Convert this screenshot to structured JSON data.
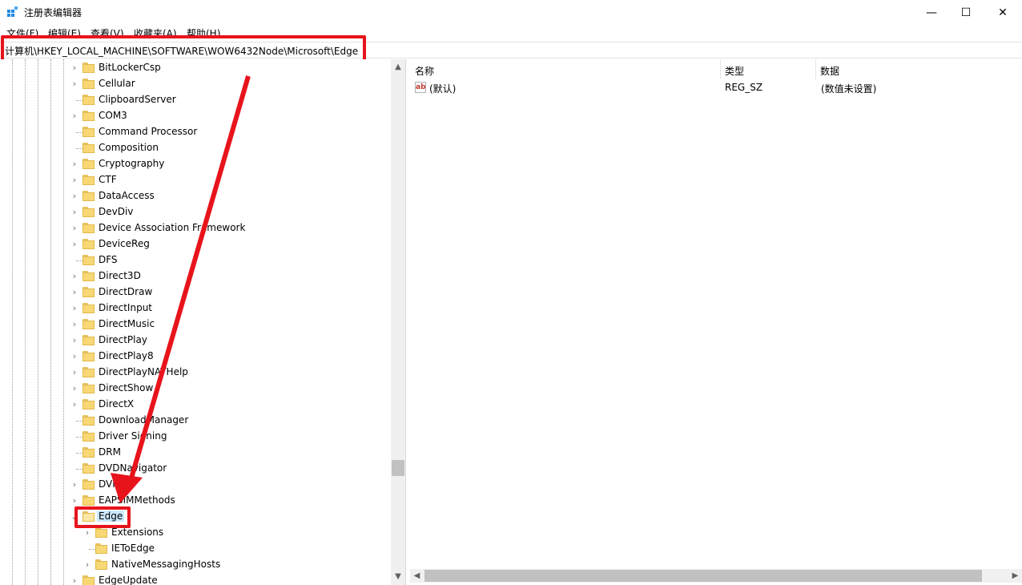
{
  "window": {
    "title": "注册表编辑器",
    "minimize_glyph": "—",
    "maximize_glyph": "☐",
    "close_glyph": "✕"
  },
  "menu": {
    "file": "文件(F)",
    "edit": "编辑(E)",
    "view": "查看(V)",
    "favorites": "收藏夹(A)",
    "help": "帮助(H)"
  },
  "address": {
    "path": "计算机\\HKEY_LOCAL_MACHINE\\SOFTWARE\\WOW6432Node\\Microsoft\\Edge"
  },
  "tree": {
    "items": [
      {
        "label": "BitLockerCsp",
        "expandable": true,
        "level": 1
      },
      {
        "label": "Cellular",
        "expandable": true,
        "level": 1
      },
      {
        "label": "ClipboardServer",
        "expandable": false,
        "level": 1
      },
      {
        "label": "COM3",
        "expandable": true,
        "level": 1
      },
      {
        "label": "Command Processor",
        "expandable": false,
        "level": 1
      },
      {
        "label": "Composition",
        "expandable": false,
        "level": 1
      },
      {
        "label": "Cryptography",
        "expandable": true,
        "level": 1
      },
      {
        "label": "CTF",
        "expandable": true,
        "level": 1
      },
      {
        "label": "DataAccess",
        "expandable": true,
        "level": 1
      },
      {
        "label": "DevDiv",
        "expandable": true,
        "level": 1
      },
      {
        "label": "Device Association Framework",
        "expandable": true,
        "level": 1
      },
      {
        "label": "DeviceReg",
        "expandable": true,
        "level": 1
      },
      {
        "label": "DFS",
        "expandable": false,
        "level": 1
      },
      {
        "label": "Direct3D",
        "expandable": true,
        "level": 1
      },
      {
        "label": "DirectDraw",
        "expandable": true,
        "level": 1
      },
      {
        "label": "DirectInput",
        "expandable": true,
        "level": 1
      },
      {
        "label": "DirectMusic",
        "expandable": true,
        "level": 1
      },
      {
        "label": "DirectPlay",
        "expandable": true,
        "level": 1
      },
      {
        "label": "DirectPlay8",
        "expandable": true,
        "level": 1
      },
      {
        "label": "DirectPlayNATHelp",
        "expandable": true,
        "level": 1
      },
      {
        "label": "DirectShow",
        "expandable": true,
        "level": 1
      },
      {
        "label": "DirectX",
        "expandable": true,
        "level": 1
      },
      {
        "label": "DownloadManager",
        "expandable": false,
        "level": 1
      },
      {
        "label": "Driver Signing",
        "expandable": false,
        "level": 1
      },
      {
        "label": "DRM",
        "expandable": false,
        "level": 1
      },
      {
        "label": "DVDNavigator",
        "expandable": false,
        "level": 1
      },
      {
        "label": "DVR",
        "expandable": true,
        "level": 1
      },
      {
        "label": "EAPSIMMethods",
        "expandable": true,
        "level": 1
      },
      {
        "label": "Edge",
        "expandable": true,
        "expanded": true,
        "selected": true,
        "level": 1
      },
      {
        "label": "Extensions",
        "expandable": true,
        "level": 2
      },
      {
        "label": "IEToEdge",
        "expandable": false,
        "level": 2
      },
      {
        "label": "NativeMessagingHosts",
        "expandable": true,
        "level": 2
      },
      {
        "label": "EdgeUpdate",
        "expandable": true,
        "level": 1
      }
    ]
  },
  "list": {
    "columns": {
      "name": "名称",
      "type": "类型",
      "data": "数据"
    },
    "rows": [
      {
        "name": "(默认)",
        "type": "REG_SZ",
        "data": "(数值未设置)",
        "icon": "string-value-icon",
        "icon_text": "ab"
      }
    ]
  },
  "colors": {
    "highlight_red": "#e8141c",
    "selection_blue": "#cce8ff",
    "folder_yellow": "#f8d775"
  }
}
